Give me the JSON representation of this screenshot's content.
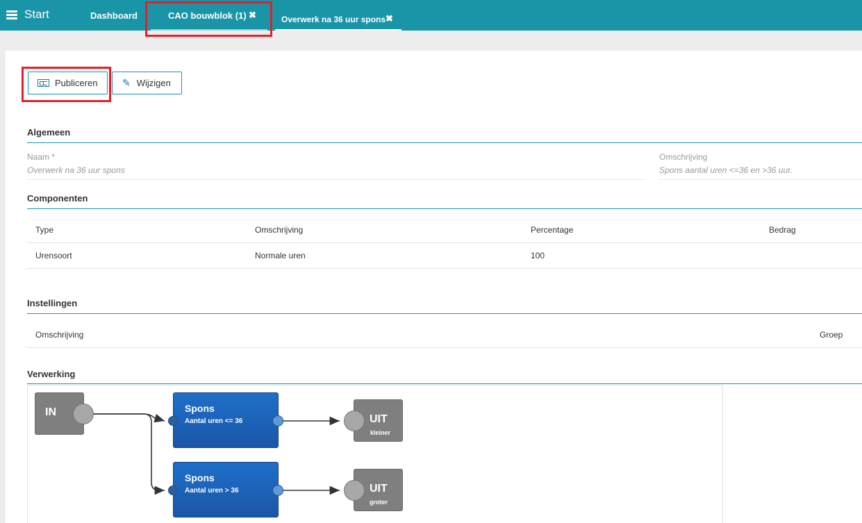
{
  "topbar": {
    "menu_label": "Start",
    "tabs": [
      {
        "label": "Dashboard"
      },
      {
        "label": "CAO bouwblok (1)",
        "close": "✖"
      },
      {
        "label": "Overwerk na 36 uur spons",
        "close": "✖"
      }
    ]
  },
  "toolbar": {
    "publish_label": "Publiceren",
    "edit_label": "Wijzigen"
  },
  "sections": {
    "general": "Algemeen",
    "components": "Componenten",
    "settings": "Instellingen",
    "processing": "Verwerking"
  },
  "general": {
    "name_label": "Naam *",
    "name_value": "Overwerk na 36 uur spons",
    "desc_label": "Omschrijving",
    "desc_value": "Spons aantal uren <=36 en >36 uur."
  },
  "components_table": {
    "headers": [
      "Type",
      "Omschrijving",
      "Percentage",
      "Bedrag"
    ],
    "rows": [
      [
        "Urensoort",
        "Normale uren",
        "100",
        ""
      ]
    ]
  },
  "settings_table": {
    "headers": [
      "Omschrijving",
      "Groep"
    ]
  },
  "diagram": {
    "in_label": "IN",
    "nodes": [
      {
        "title": "Spons",
        "subtitle": "Aantal uren <= 36"
      },
      {
        "title": "Spons",
        "subtitle": "Aantal uren > 36"
      }
    ],
    "outputs": [
      {
        "title": "UIT",
        "subtitle": "kleiner"
      },
      {
        "title": "UIT",
        "subtitle": "groter"
      }
    ]
  },
  "colors": {
    "accent": "#1a95a8",
    "highlight": "#e0202a",
    "node_blue": "#1b5fb8",
    "node_gray": "#7f7f7f",
    "port_blue": "#5b9bdc"
  }
}
